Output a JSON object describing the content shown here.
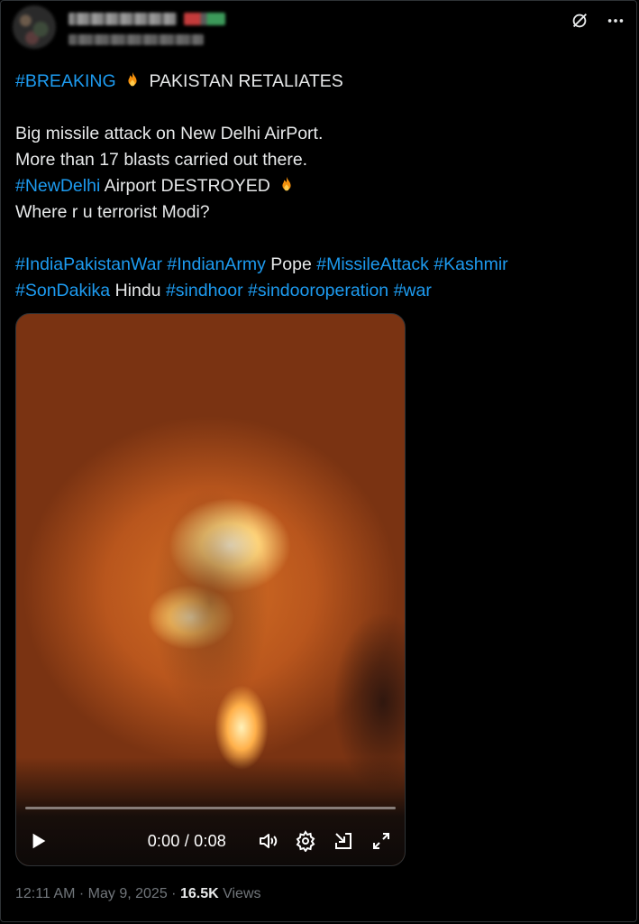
{
  "header": {
    "more_icon": "more-horizontal-icon",
    "grok_icon": "grok-slash-icon"
  },
  "tweet": {
    "line1_hashtag": "#BREAKING",
    "line1_text": "PAKISTAN RETALIATES",
    "line2": "Big missile attack on New Delhi AirPort.",
    "line3": "More than 17 blasts carried out there.",
    "line4_hashtag": "#NewDelhi",
    "line4_text": "Airport DESTROYED",
    "line5": "Where r u terrorist Modi?",
    "tags1": {
      "t1": "#IndiaPakistanWar",
      "t2": "#IndianArmy",
      "word": "Pope",
      "t3": "#MissileAttack",
      "t4": "#Kashmir"
    },
    "tags2": {
      "t1": "#SonDakika",
      "word": "Hindu",
      "t2": "#sindhoor",
      "t3": "#sindooroperation",
      "t4": "#war"
    },
    "emoji": "fire-emoji"
  },
  "video": {
    "time": "0:00 / 0:08",
    "progress": 0
  },
  "meta": {
    "time": "12:11 AM",
    "sep1": "·",
    "date": "May 9, 2025",
    "sep2": "·",
    "views_count": "16.5K",
    "views_label": "Views"
  },
  "colors": {
    "accent": "#1d9bf0",
    "text": "#e7e9ea",
    "muted": "#71767b",
    "background": "#000000"
  }
}
